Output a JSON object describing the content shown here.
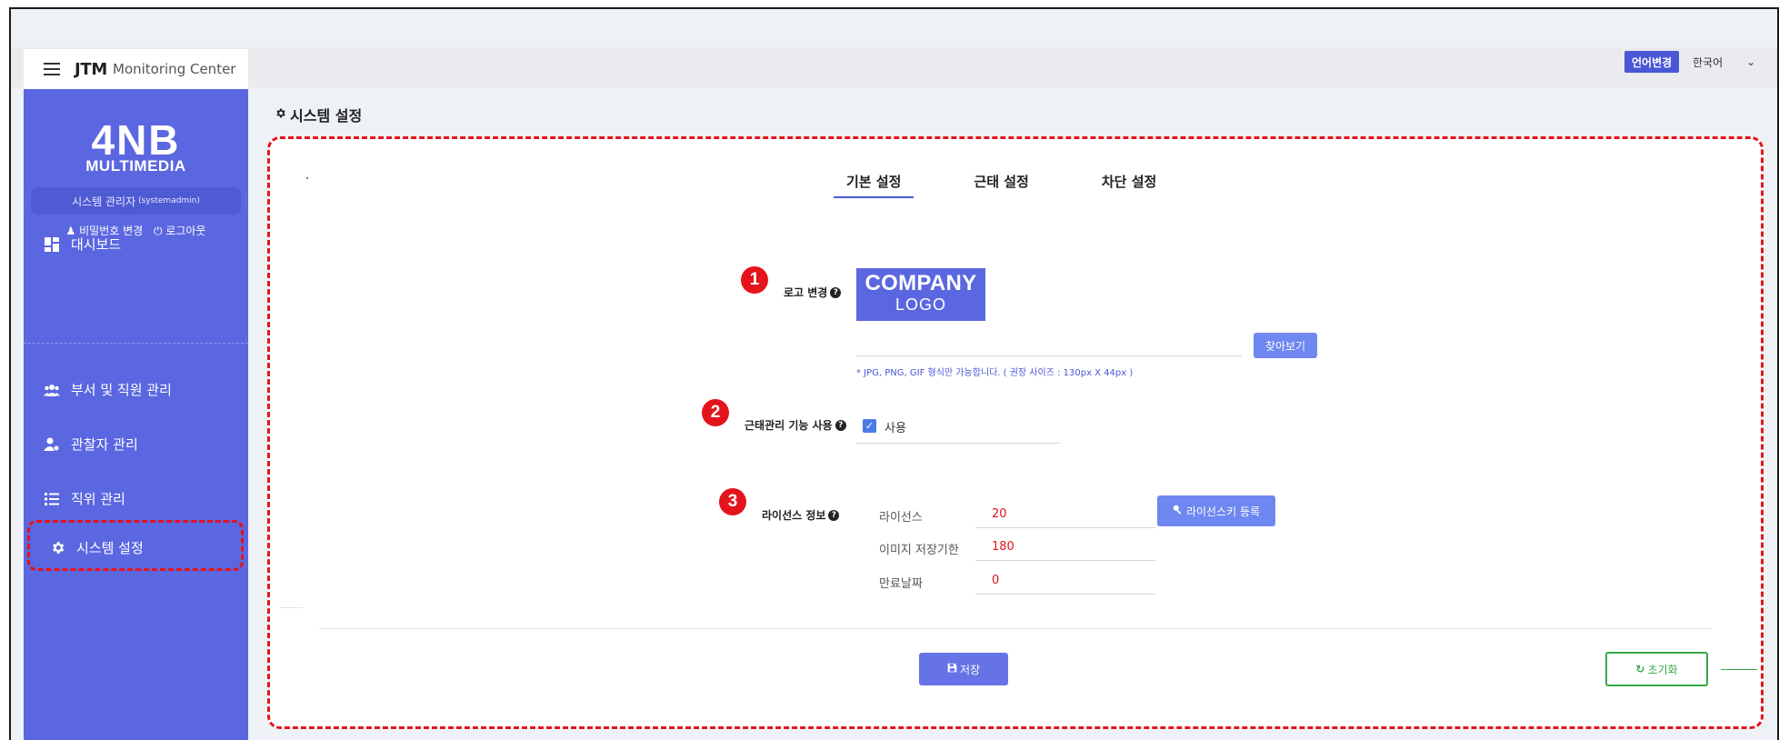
{
  "app": {
    "title": "JTM",
    "subtitle": "Monitoring Center"
  },
  "topbar": {
    "lang_button": "언어변경",
    "lang_selected": "한국어"
  },
  "sidebar": {
    "logo_main": "4NB",
    "logo_sub": "MULTIMEDIA",
    "admin_name": "시스템 관리자",
    "admin_id": "(systemadmin)",
    "link_password": "비밀번호 변경",
    "link_logout": "로그아웃",
    "items": [
      {
        "label": "대시보드",
        "icon": "dashboard-icon"
      },
      {
        "label": "부서 및 직원 관리",
        "icon": "people-icon"
      },
      {
        "label": "관찰자 관리",
        "icon": "user-gear-icon"
      },
      {
        "label": "직위 관리",
        "icon": "list-icon"
      },
      {
        "label": "시스템 설정",
        "icon": "gear-icon"
      }
    ]
  },
  "page": {
    "title": "시스템 설정"
  },
  "tabs": [
    "기본 설정",
    "근태 설정",
    "차단 설정"
  ],
  "settings": {
    "logo": {
      "badge": "1",
      "label": "로고 변경",
      "preview_line1": "COMPANY",
      "preview_line2": "LOGO",
      "browse_button": "찾아보기",
      "hint": "* JPG, PNG, GIF 형식만 가능합니다. ( 권장 사이즈 : 130px X 44px )"
    },
    "attendance": {
      "badge": "2",
      "label": "근태관리 기능 사용",
      "checkbox_label": "사용",
      "checked": true
    },
    "license": {
      "badge": "3",
      "label": "라이선스 정보",
      "rows": [
        {
          "label": "라이선스",
          "value": "20"
        },
        {
          "label": "이미지 저장기한",
          "value": "180"
        },
        {
          "label": "만료날짜",
          "value": "0"
        }
      ],
      "register_button": "라이선스키 등록"
    }
  },
  "footer": {
    "save_button": "저장",
    "reset_button": "초기화"
  },
  "colors": {
    "sidebar": "#5b67e0",
    "accent": "#4a57d6",
    "highlight": "#e3141c",
    "reset": "#37a84a"
  }
}
